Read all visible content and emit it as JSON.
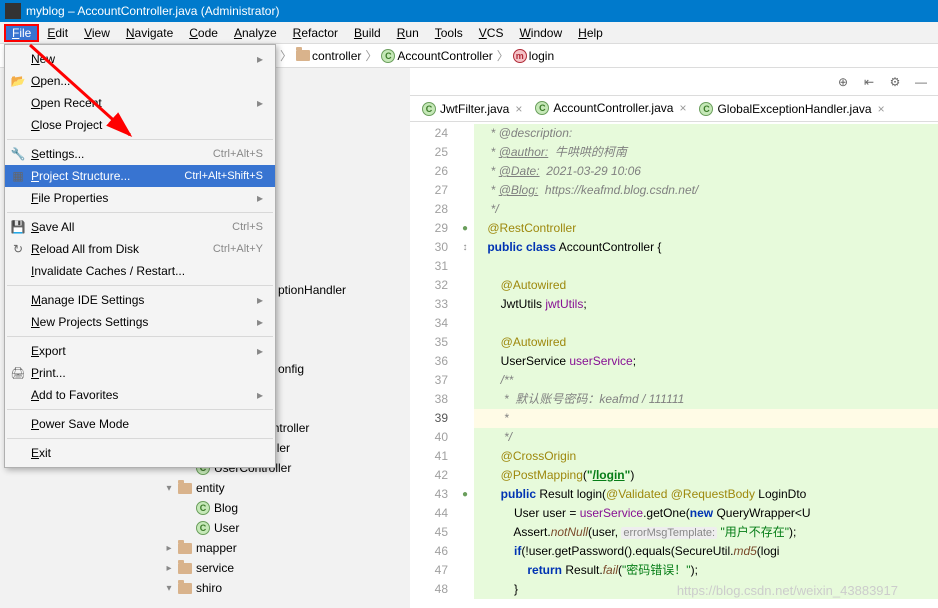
{
  "title": "myblog – AccountController.java (Administrator)",
  "menubar": [
    "File",
    "Edit",
    "View",
    "Navigate",
    "Code",
    "Analyze",
    "Refactor",
    "Build",
    "Run",
    "Tools",
    "VCS",
    "Window",
    "Help"
  ],
  "breadcrumbs": {
    "pkg": "controller",
    "cls": "AccountController",
    "mth": "login"
  },
  "file_menu": [
    {
      "label": "New",
      "sub": true
    },
    {
      "label": "Open...",
      "icon": "📂"
    },
    {
      "label": "Open Recent",
      "sub": true
    },
    {
      "label": "Close Project"
    },
    {
      "sep": true
    },
    {
      "label": "Settings...",
      "icon": "🔧",
      "shortcut": "Ctrl+Alt+S"
    },
    {
      "label": "Project Structure...",
      "icon": "▦",
      "shortcut": "Ctrl+Alt+Shift+S",
      "hi": true
    },
    {
      "label": "File Properties",
      "sub": true
    },
    {
      "sep": true
    },
    {
      "label": "Save All",
      "icon": "💾",
      "shortcut": "Ctrl+S"
    },
    {
      "label": "Reload All from Disk",
      "icon": "↻",
      "shortcut": "Ctrl+Alt+Y"
    },
    {
      "label": "Invalidate Caches / Restart..."
    },
    {
      "sep": true
    },
    {
      "label": "Manage IDE Settings",
      "sub": true
    },
    {
      "label": "New Projects Settings",
      "sub": true
    },
    {
      "sep": true
    },
    {
      "label": "Export",
      "sub": true
    },
    {
      "label": "Print...",
      "icon": "🖨"
    },
    {
      "label": "Add to Favorites",
      "sub": true
    },
    {
      "sep": true
    },
    {
      "label": "Power Save Mode"
    },
    {
      "sep": true
    },
    {
      "label": "Exit"
    }
  ],
  "tree_visible": {
    "handler": "ptionHandler",
    "cfg": "onfig"
  },
  "tree": [
    {
      "indent": 0,
      "icon": "c",
      "label": "AccountController"
    },
    {
      "indent": 0,
      "icon": "c",
      "label": "BlogController"
    },
    {
      "indent": 0,
      "icon": "c",
      "label": "UserController"
    },
    {
      "indent": -1,
      "exp": "v",
      "icon": "folder",
      "label": "entity"
    },
    {
      "indent": 0,
      "icon": "c",
      "label": "Blog"
    },
    {
      "indent": 0,
      "icon": "c",
      "label": "User"
    },
    {
      "indent": -1,
      "exp": ">",
      "icon": "folder",
      "label": "mapper"
    },
    {
      "indent": -1,
      "exp": ">",
      "icon": "folder",
      "label": "service"
    },
    {
      "indent": -1,
      "exp": "v",
      "icon": "folder",
      "label": "shiro"
    }
  ],
  "tabs": [
    {
      "label": "JwtFilter.java"
    },
    {
      "label": "AccountController.java",
      "active": true
    },
    {
      "label": "GlobalExceptionHandler.java"
    }
  ],
  "code": {
    "first_line": 24,
    "lines": [
      {
        "n": 24,
        "html": "     <span class='cm'>* @description:</span>",
        "bg": true
      },
      {
        "n": 25,
        "html": "     <span class='cm'>* <span class='link'>@author:</span>  牛哄哄的柯南</span>",
        "bg": true
      },
      {
        "n": 26,
        "html": "     <span class='cm'>* <span class='link'>@Date:</span>  2021-03-29 10:06</span>",
        "bg": true
      },
      {
        "n": 27,
        "html": "     <span class='cm'>* <span class='link'>@Blog:</span>  https://keafmd.blog.csdn.net/</span>",
        "bg": true
      },
      {
        "n": 28,
        "html": "     <span class='cm'>*/</span>",
        "bg": true
      },
      {
        "n": 29,
        "html": "    <span class='an'>@RestController</span>",
        "bg": true,
        "mark": "●"
      },
      {
        "n": 30,
        "html": "    <span class='k'>public class</span> AccountController {",
        "bg": true,
        "mark": "↕"
      },
      {
        "n": 31,
        "html": "",
        "bg": true
      },
      {
        "n": 32,
        "html": "        <span class='an'>@Autowired</span>",
        "bg": true
      },
      {
        "n": 33,
        "html": "        JwtUtils <span class='fld'>jwtUtils</span>;",
        "bg": true
      },
      {
        "n": 34,
        "html": "",
        "bg": true
      },
      {
        "n": 35,
        "html": "        <span class='an'>@Autowired</span>",
        "bg": true
      },
      {
        "n": 36,
        "html": "        UserService <span class='fld'>userService</span>;",
        "bg": true
      },
      {
        "n": 37,
        "html": "        <span class='cm'>/**</span>",
        "bg": true
      },
      {
        "n": 38,
        "html": "        <span class='cm'> *  默认账号密码：<span class='cmi'>keafmd</span> / 111111</span>",
        "bg": true
      },
      {
        "n": 39,
        "html": "        <span class='cm'> *</span>",
        "hl": true,
        "cur": true
      },
      {
        "n": 40,
        "html": "        <span class='cm'> */</span>",
        "bg": true
      },
      {
        "n": 41,
        "html": "        <span class='an'>@CrossOrigin</span>",
        "bg": true
      },
      {
        "n": 42,
        "html": "        <span class='an'>@PostMapping</span>(<span class='strb'>&quot;<u>/login</u>&quot;</span>)",
        "bg": true
      },
      {
        "n": 43,
        "html": "        <span class='k'>public</span> Result login(<span class='an'>@Validated</span> <span class='an'>@RequestBody</span> LoginDto",
        "bg": true,
        "mark": "●o"
      },
      {
        "n": 44,
        "html": "            User user = <span class='fld'>userService</span>.getOne(<span class='k'>new</span> QueryWrapper&lt;U",
        "bg": true
      },
      {
        "n": 45,
        "html": "            Assert.<span class='mcall'>notNull</span>(user, <span class='param-hint'>errorMsgTemplate:</span> <span class='str'>&quot;用户不存在&quot;</span>);",
        "bg": true
      },
      {
        "n": 46,
        "html": "            <span class='k'>if</span>(!user.getPassword().equals(SecureUtil.<span class='mcall'>md5</span>(logi",
        "bg": true
      },
      {
        "n": 47,
        "html": "                <span class='k'>return</span> Result.<span class='mcall'>fail</span>(<span class='str'>&quot;密码错误！&quot;</span>);",
        "bg": true
      },
      {
        "n": 48,
        "html": "            }",
        "bg": true
      }
    ]
  },
  "watermark": "https://blog.csdn.net/weixin_43883917"
}
